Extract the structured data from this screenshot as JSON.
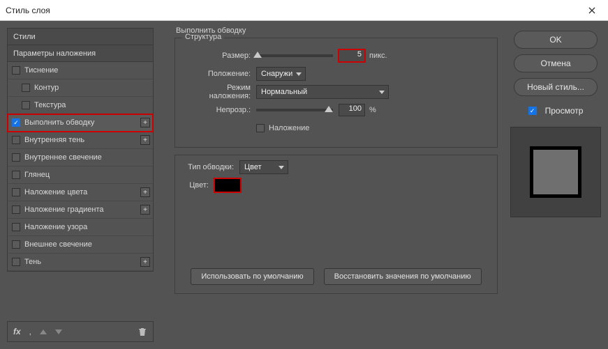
{
  "title": "Стиль слоя",
  "sidebar": {
    "headers": {
      "styles": "Стили",
      "blending": "Параметры наложения"
    },
    "items": [
      {
        "label": "Тиснение",
        "checked": false,
        "plus": false,
        "indent": 0
      },
      {
        "label": "Контур",
        "checked": false,
        "plus": false,
        "indent": 1
      },
      {
        "label": "Текстура",
        "checked": false,
        "plus": false,
        "indent": 1
      },
      {
        "label": "Выполнить обводку",
        "checked": true,
        "plus": true,
        "indent": 0,
        "selected": true
      },
      {
        "label": "Внутренняя тень",
        "checked": false,
        "plus": true,
        "indent": 0
      },
      {
        "label": "Внутреннее свечение",
        "checked": false,
        "plus": false,
        "indent": 0
      },
      {
        "label": "Глянец",
        "checked": false,
        "plus": false,
        "indent": 0
      },
      {
        "label": "Наложение цвета",
        "checked": false,
        "plus": true,
        "indent": 0
      },
      {
        "label": "Наложение градиента",
        "checked": false,
        "plus": true,
        "indent": 0
      },
      {
        "label": "Наложение узора",
        "checked": false,
        "plus": false,
        "indent": 0
      },
      {
        "label": "Внешнее свечение",
        "checked": false,
        "plus": false,
        "indent": 0
      },
      {
        "label": "Тень",
        "checked": false,
        "plus": true,
        "indent": 0
      }
    ],
    "footer_fx": "fx"
  },
  "center": {
    "section_title": "Выполнить обводку",
    "structure_legend": "Структура",
    "labels": {
      "size": "Размер:",
      "position": "Положение:",
      "blend": "Режим наложения:",
      "opacity": "Непрозр.:",
      "overprint": "Наложение",
      "fill_type": "Тип обводки:",
      "color": "Цвет:"
    },
    "values": {
      "size": "5",
      "size_unit": "пикс.",
      "position": "Снаружи",
      "blend": "Нормальный",
      "opacity": "100",
      "opacity_unit": "%",
      "fill_type": "Цвет",
      "color_hex": "#000000"
    },
    "buttons": {
      "make_default": "Использовать по умолчанию",
      "reset_default": "Восстановить значения по умолчанию"
    }
  },
  "right": {
    "ok": "OK",
    "cancel": "Отмена",
    "new_style": "Новый стиль...",
    "preview_label": "Просмотр",
    "preview_checked": true
  }
}
